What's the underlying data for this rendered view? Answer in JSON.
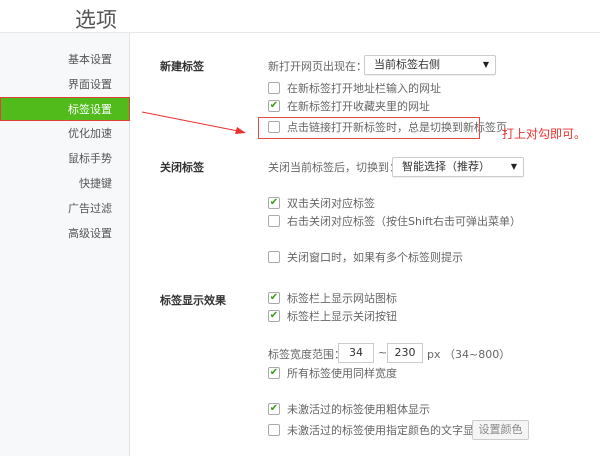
{
  "window": {
    "title": "选项"
  },
  "sidebar": {
    "items": [
      {
        "label": "基本设置"
      },
      {
        "label": "界面设置"
      },
      {
        "label": "标签设置",
        "active": true
      },
      {
        "label": "优化加速"
      },
      {
        "label": "鼠标手势"
      },
      {
        "label": "快捷键"
      },
      {
        "label": "广告过滤"
      },
      {
        "label": "高级设置"
      }
    ]
  },
  "new_tab": {
    "heading": "新建标签",
    "open_label": "新打开网页出现在：",
    "open_value": "当前标签右侧",
    "options": [
      {
        "label": "在新标签打开地址栏输入的网址",
        "checked": false
      },
      {
        "label": "在新标签打开收藏夹里的网址",
        "checked": true
      },
      {
        "label": "点击链接打开新标签时，总是切换到新标签页",
        "checked": false
      }
    ]
  },
  "close_tab": {
    "heading": "关闭标签",
    "switch_label": "关闭当前标签后，切换到：",
    "switch_value": "智能选择（推荐）",
    "options": [
      {
        "label": "双击关闭对应标签",
        "checked": true
      },
      {
        "label": "右击关闭对应标签（按住Shift右击可弹出菜单）",
        "checked": false
      },
      {
        "label": "关闭窗口时，如果有多个标签则提示",
        "checked": false
      }
    ]
  },
  "display": {
    "heading": "标签显示效果",
    "options": [
      {
        "label": "标签栏上显示网站图标",
        "checked": true
      },
      {
        "label": "标签栏上显示关闭按钮",
        "checked": true
      },
      {
        "label": "所有标签使用同样宽度",
        "checked": true
      },
      {
        "label": "未激活过的标签使用粗体显示",
        "checked": true
      },
      {
        "label": "未激活过的标签使用指定颜色的文字显示：",
        "checked": false
      }
    ],
    "width_label": "标签宽度范围：",
    "width_min": "34",
    "tilde": "~",
    "width_max": "230",
    "width_hint": "px （34~800）",
    "color_button": "设置颜色"
  },
  "annotation": {
    "note": "打上对勾即可。",
    "color": "#e8322f"
  },
  "check_mark": "✔"
}
